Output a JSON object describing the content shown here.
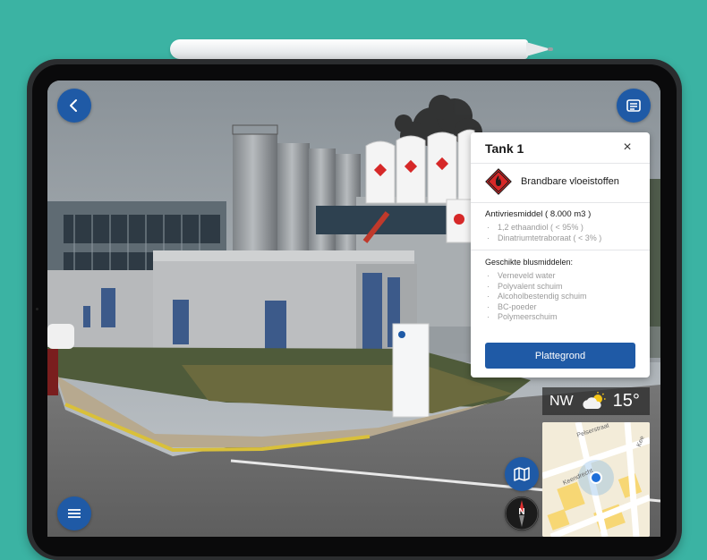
{
  "panel": {
    "title": "Tank 1",
    "close": "×",
    "hazard_label": "Brandbare vloeistoffen",
    "substance": "Antivriesmiddel ( 8.000 m3 )",
    "components": [
      "1,2 ethaandiol ( < 95% )",
      "Dinatriumtetraboraat ( < 3% )"
    ],
    "extinguishers_title": "Geschikte blusmiddelen:",
    "extinguishers": [
      "Verneveld water",
      "Polyvalent schuim",
      "Alcoholbestendig schuim",
      "BC-poeder",
      "Polymeerschuim"
    ],
    "button_label": "Plattegrond"
  },
  "weather": {
    "direction": "NW",
    "temperature": "15°",
    "icon": "partly-sunny-icon"
  },
  "minimap": {
    "streets": [
      "Pelserstraat",
      "Keendrecht",
      "Kee"
    ]
  },
  "compass": {
    "label": "N"
  },
  "icons": {
    "back": "back-arrow-icon",
    "notes": "notes-icon",
    "menu": "hamburger-menu-icon",
    "map": "map-icon",
    "compass": "compass-icon"
  },
  "colors": {
    "accent": "#1f5aa6",
    "background": "#3bb3a3",
    "hazard": "#d62828"
  }
}
